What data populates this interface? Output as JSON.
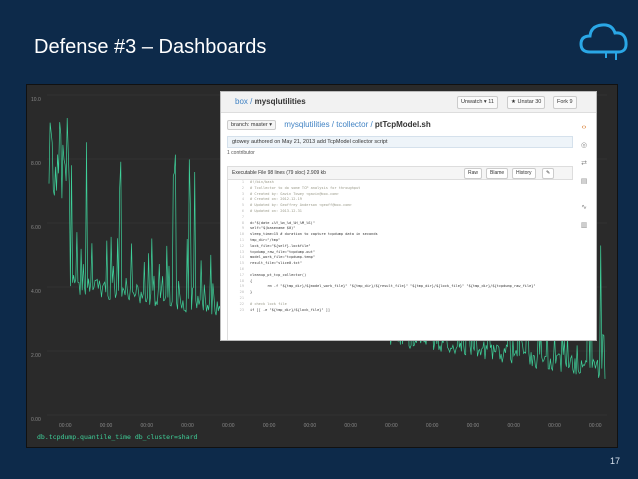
{
  "slide": {
    "title": "Defense #3 – Dashboards",
    "page_number": "17"
  },
  "graph": {
    "y_ticks": [
      "10.0",
      "8.00",
      "6.00",
      "4.00",
      "2.00",
      "0.00"
    ],
    "x_ticks": [
      "00:00",
      "00:00",
      "00:00",
      "00:00",
      "00:00",
      "00:00",
      "00:00",
      "00:00",
      "00:00",
      "00:00",
      "00:00",
      "00:00",
      "00:00",
      "00:00"
    ],
    "legend": "db.tcpdump.quantile_time db_cluster=shard",
    "line_color": "#3fd19a"
  },
  "github": {
    "repo_owner": "box",
    "repo_name": "mysqlutilities",
    "unwatch_label": "Unwatch ▾",
    "unwatch_count": "11",
    "unstar_label": "Unstar",
    "unstar_count": "30",
    "fork_label": "Fork",
    "fork_count": "9",
    "branch_label": "branch: master ▾",
    "path_repo": "mysqlutilities",
    "path_dir": "tcollector",
    "path_file": "ptTcpModel.sh",
    "commit_text": "gtowey  authored on May 21, 2013  add TcpModel collector script",
    "contributors": "1 contributor",
    "file_info": "Executable File   98 lines (79 sloc)   2.909 kb",
    "btn_raw": "Raw",
    "btn_blame": "Blame",
    "btn_history": "History",
    "code_lines": [
      "#!/bin/bash",
      "# Tcollector to do some TCP analysis for throughput",
      "# Created by: Gavin Towey <gavin@box.com>",
      "# Created on: 2012-12-19",
      "# Updated by: Geoffrey Anderson <geoff@box.com>",
      "# Updated on: 2013-12-31",
      "",
      "d=\"$(date +%Y_%m_%d_%H_%M_%S)\"",
      "self=\"$(basename $0)\"",
      "sleep_time=15 # duration to capture tcpdump data in seconds",
      "tmp_dir=\"/tmp\"",
      "lock_file=\"${self}.lockfile\"",
      "tcpdump_raw_file=\"tcpdump.out\"",
      "model_work_file=\"tcpdump.temp\"",
      "result_file=\"slice0.txt\"",
      "",
      "cleanup_pt_tcp_collector()",
      "{",
      "        rm -f \"${tmp_dir}/${model_work_file}\" \"${tmp_dir}/${result_file}\" \"${tmp_dir}/${lock_file}\" \"${tmp_dir}/${tcpdump_raw_file}\"",
      "}",
      "",
      "# check lock file",
      "if [[ -e \"${tmp_dir}/${lock_file}\" ]]"
    ]
  }
}
